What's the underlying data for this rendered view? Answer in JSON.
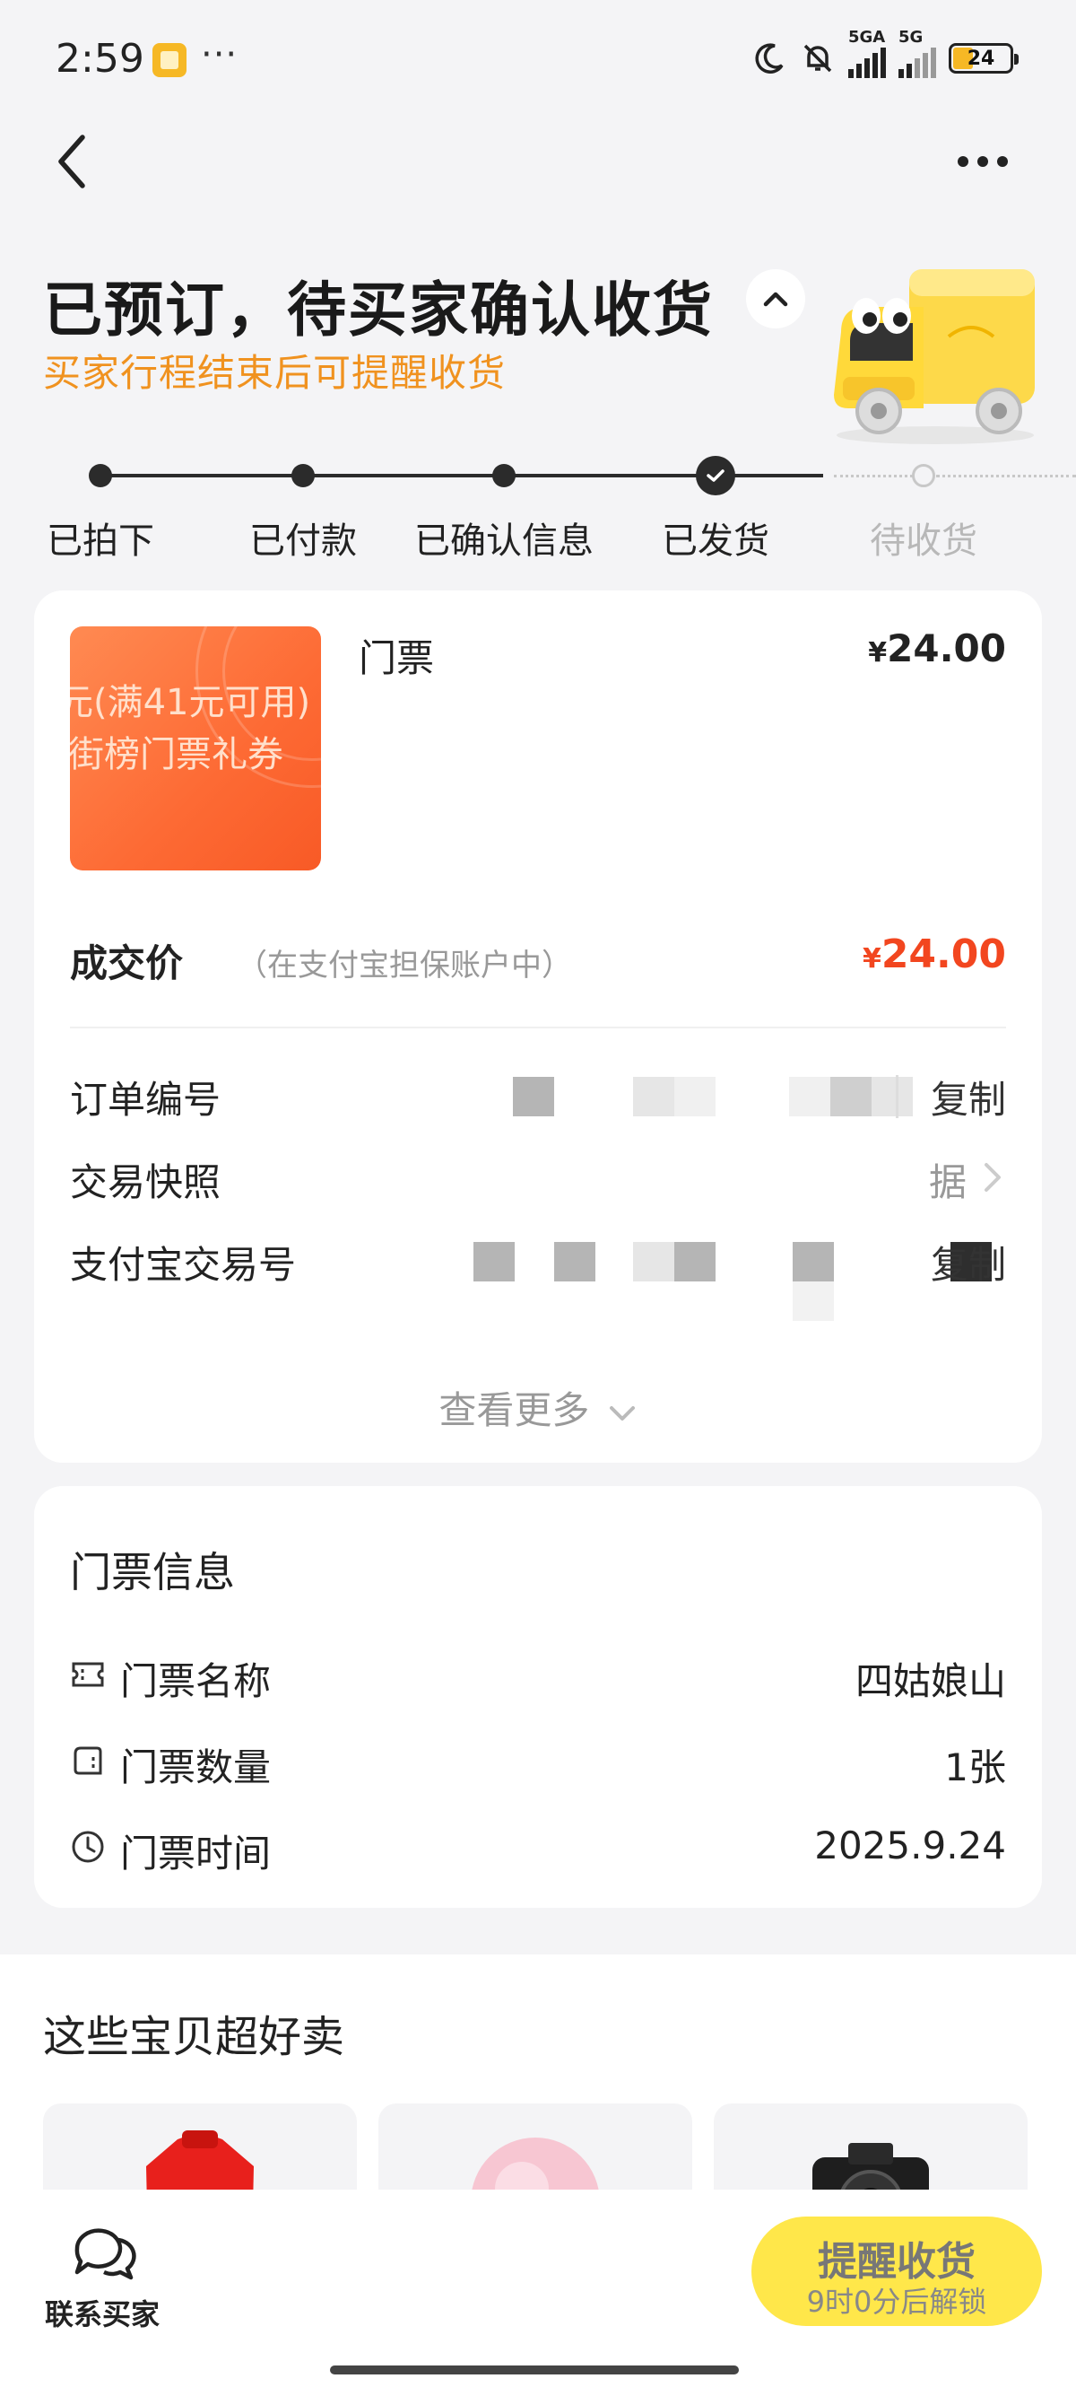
{
  "status_bar": {
    "time": "2:59",
    "more": "···",
    "net1": "5GA",
    "net2": "5G",
    "battery": "24"
  },
  "header": {
    "title": "已预订，待买家确认收货",
    "subtitle": "买家行程结束后可提醒收货"
  },
  "progress": {
    "steps": [
      {
        "label": "已拍下",
        "state": "done"
      },
      {
        "label": "已付款",
        "state": "done"
      },
      {
        "label": "已确认信息",
        "state": "done"
      },
      {
        "label": "已发货",
        "state": "current"
      },
      {
        "label": "待收货",
        "state": "pending"
      }
    ]
  },
  "order": {
    "product_image_text": [
      "元(满41元可用)",
      "街榜门票礼券"
    ],
    "product_name": "门票",
    "product_price_symbol": "¥",
    "product_price": "24.00",
    "deal_label": "成交价",
    "deal_note": "（在支付宝担保账户中）",
    "deal_symbol": "¥",
    "deal_amount": "24.00",
    "rows": {
      "order_no_label": "订单编号",
      "order_no_action": "复制",
      "snapshot_label": "交易快照",
      "snapshot_action": "据",
      "alipay_no_label": "支付宝交易号",
      "alipay_no_action": "复制"
    },
    "view_more": "查看更多"
  },
  "ticket_info": {
    "title": "门票信息",
    "rows": [
      {
        "icon": "ticket-icon",
        "label": "门票名称",
        "value": "四姑娘山"
      },
      {
        "icon": "wallet-icon",
        "label": "门票数量",
        "value": "1张"
      },
      {
        "icon": "clock-icon",
        "label": "门票时间",
        "value": "2025.9.24"
      }
    ]
  },
  "recommendations": {
    "title": "这些宝贝超好卖"
  },
  "bottom_bar": {
    "contact_label": "联系买家",
    "remind_title": "提醒收货",
    "remind_sub": "9时0分后解锁"
  },
  "colors": {
    "accent_orange": "#f0921f",
    "price_red": "#f2461f",
    "button_yellow": "#ffe74a",
    "background": "#f4f4f6"
  }
}
